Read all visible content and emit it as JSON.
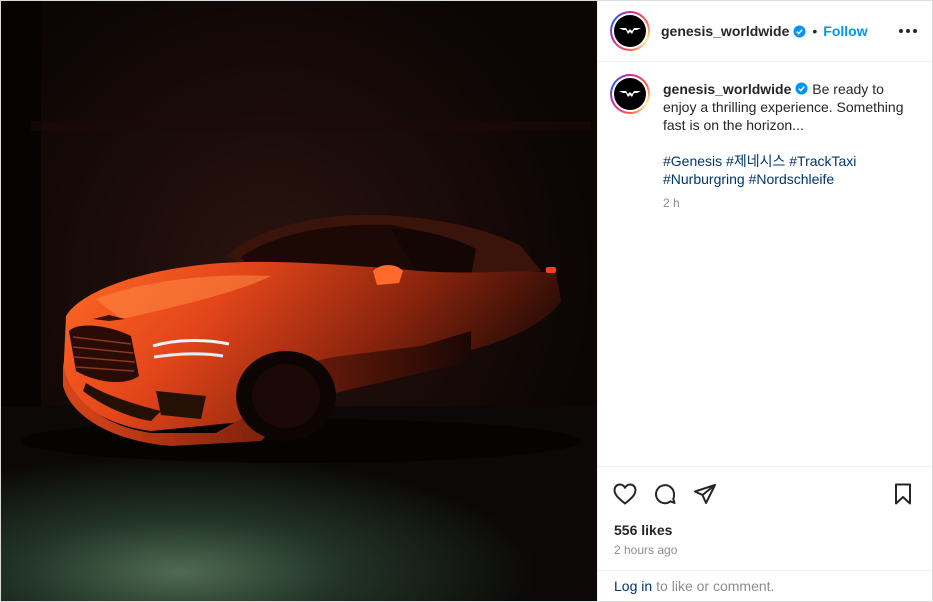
{
  "post": {
    "image_alt": "Orange Genesis car in dark room",
    "account": {
      "username": "genesis_worldwide",
      "verified": true
    },
    "header": {
      "separator": "•",
      "follow_label": "Follow"
    },
    "caption": {
      "text": "Be ready to enjoy a thrilling experience. Something fast is on the horizon...",
      "hashtags": [
        "#Genesis",
        "#제네시스",
        "#TrackTaxi",
        "#Nurburgring",
        "#Nordschleife"
      ],
      "relative_time": "2 h"
    },
    "actions": {
      "like_icon": "heart-icon",
      "comment_icon": "comment-icon",
      "share_icon": "share-icon",
      "save_icon": "bookmark-icon"
    },
    "likes_text": "556 likes",
    "posted_time": "2 hours ago",
    "login": {
      "link_label": "Log in",
      "suffix": "to like or comment."
    }
  },
  "colors": {
    "accent": "#0095f6",
    "hashtag": "#00376b",
    "muted": "#8e8e8e",
    "car": "#e24a12"
  }
}
